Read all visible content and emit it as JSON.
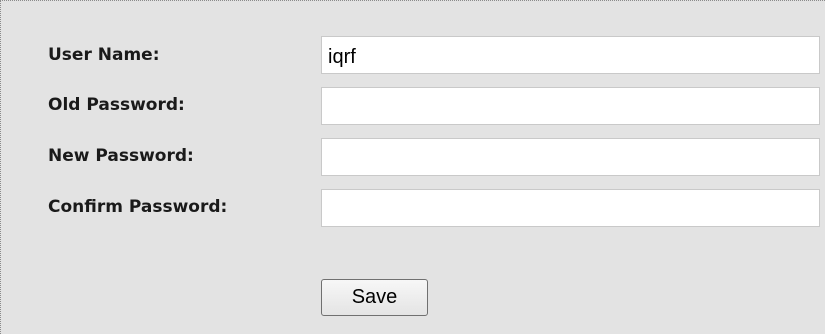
{
  "form": {
    "username_label": "User Name:",
    "username_value": "iqrf",
    "old_password_label": "Old Password:",
    "old_password_value": "",
    "new_password_label": "New Password:",
    "new_password_value": "",
    "confirm_password_label": "Confirm Password:",
    "confirm_password_value": "",
    "save_label": "Save"
  }
}
